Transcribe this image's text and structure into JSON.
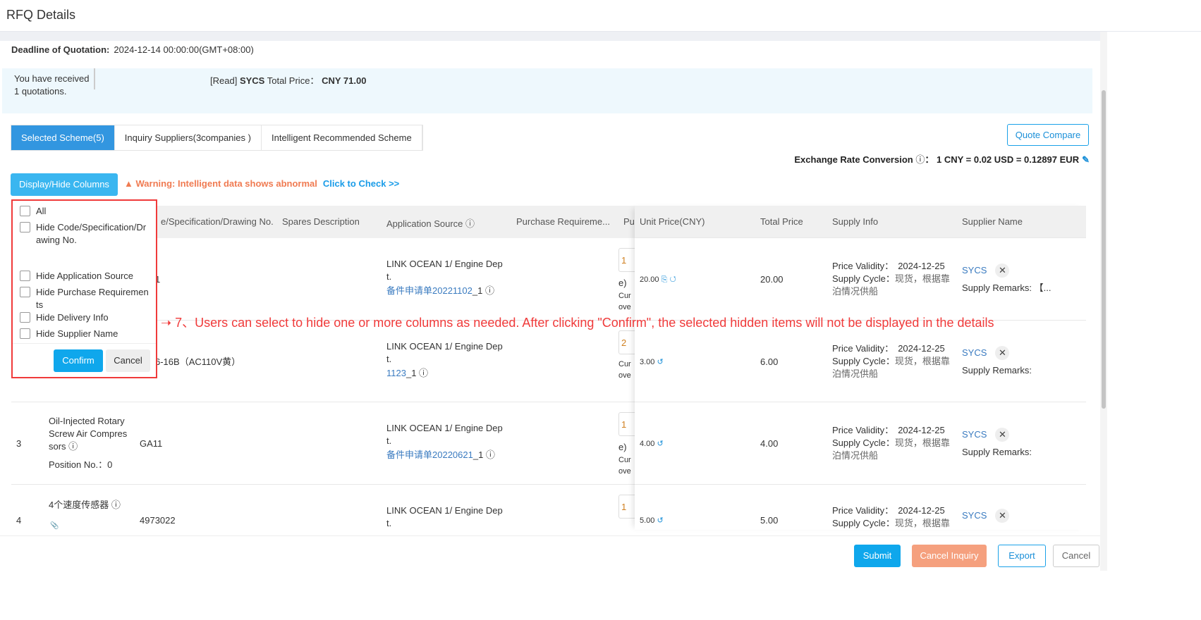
{
  "header": {
    "title": "RFQ Details"
  },
  "deadline": {
    "label": "Deadline of Quotation:",
    "value": "2024-12-14 00:00:00(GMT+08:00)"
  },
  "notice": {
    "received": "You have received 1 quotations.",
    "read": "[Read]",
    "supplier": "SYCS",
    "total_label": "Total Price：",
    "total_value": "CNY 71.00"
  },
  "tabs": [
    {
      "label": "Selected Scheme(5)",
      "active": true
    },
    {
      "label": "Inquiry Suppliers(3companies )"
    },
    {
      "label": "Intelligent Recommended Scheme"
    }
  ],
  "quote_compare": "Quote Compare",
  "exchange": {
    "label": "Exchange Rate Conversion",
    "value": "1 CNY = 0.02 USD = 0.12897 EUR"
  },
  "display_hide": "Display/Hide Columns",
  "warning": {
    "text": "Warning: Intelligent data shows abnormal",
    "link": "Click to Check >>"
  },
  "columns": {
    "code": "e/Specification/Drawing No.",
    "spares": "Spares Description",
    "app_source": "Application Source",
    "purchase": "Purchase Requireme...",
    "pu": "Pu",
    "unit_price": "Unit Price(CNY)",
    "total": "Total Price",
    "supply": "Supply Info",
    "supplier": "Supplier Name"
  },
  "rows": [
    {
      "no": "",
      "name": "",
      "position": "",
      "code": "1",
      "app": "LINK OCEAN 1/ Engine Dep",
      "app2": "t.",
      "req": "备件申请单20221102",
      "req_suffix": "_1",
      "qty": "1",
      "pu1": "e)",
      "pu2": "Cur",
      "pu3": "ove",
      "unit": "20.00",
      "total": "20.00",
      "validity": "2024-12-25",
      "cycle": "现货，根据靠",
      "cycle2": "泊情况供船",
      "supplier": "SYCS",
      "remarks": "Supply Remarks: 【..."
    },
    {
      "no": "",
      "name": "",
      "position": "",
      "code": "6-16B（AC110V黄）",
      "app": "LINK OCEAN 1/ Engine Dep",
      "app2": "t.",
      "req": "1123",
      "req_suffix": "_1",
      "qty": "2",
      "pu1": "",
      "pu2": "Cur",
      "pu3": "ove",
      "unit": "3.00",
      "total": "6.00",
      "validity": "2024-12-25",
      "cycle": "现货，根据靠",
      "cycle2": "泊情况供船",
      "supplier": "SYCS",
      "remarks": "Supply Remarks:"
    },
    {
      "no": "3",
      "name": "Oil-Injected Rotary Screw Air Compres sors",
      "position": "Position No.：0",
      "code": "GA11",
      "app": "LINK OCEAN 1/ Engine Dep",
      "app2": "t.",
      "req": "备件申请单20220621",
      "req_suffix": "_1",
      "qty": "1",
      "pu1": "e)",
      "pu2": "Cur",
      "pu3": "ove",
      "unit": "4.00",
      "total": "4.00",
      "validity": "2024-12-25",
      "cycle": "现货，根据靠",
      "cycle2": "泊情况供船",
      "supplier": "SYCS",
      "remarks": "Supply Remarks:"
    },
    {
      "no": "4",
      "name": "4个速度传感器",
      "position": "",
      "code": "4973022",
      "app": "LINK OCEAN 1/ Engine Dep",
      "app2": "t.",
      "req": "",
      "req_suffix": "",
      "qty": "1",
      "pu1": "",
      "pu2": "",
      "pu3": "",
      "unit": "5.00",
      "total": "5.00",
      "validity": "2024-12-25",
      "cycle": "现货，根据靠",
      "cycle2": "",
      "supplier": "SYCS",
      "remarks": ""
    }
  ],
  "supply_labels": {
    "validity": "Price Validity：",
    "cycle": "Supply Cycle："
  },
  "popup": {
    "options": [
      "All",
      "Hide Code/Specification/Drawing No.",
      "Hide Application Source",
      "Hide Purchase Requirements",
      "Hide Delivery Info",
      "Hide Supplier Name"
    ],
    "confirm": "Confirm",
    "cancel": "Cancel"
  },
  "annotation": "7、Users can select to hide one or more columns as needed. After clicking \"Confirm\", the selected hidden items will not be displayed in the details",
  "footer": {
    "submit": "Submit",
    "cancel_inquiry": "Cancel Inquiry",
    "export": "Export",
    "cancel": "Cancel"
  },
  "colors": {
    "primary": "#0fa7ec",
    "tab_active": "#3296e0",
    "warning": "#f07b52",
    "annotation": "#f03a3a",
    "cancel_inquiry": "#f5a07e"
  }
}
